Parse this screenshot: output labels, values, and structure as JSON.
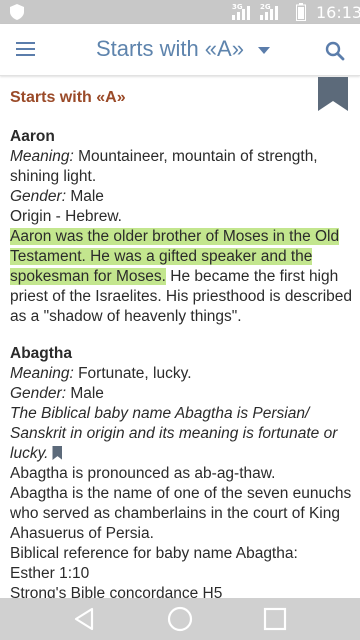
{
  "status_bar": {
    "time": "16:13",
    "network_1": "3G",
    "network_2": "2G"
  },
  "app_bar": {
    "title": "Starts with «A»"
  },
  "section": {
    "heading": "Starts with «A»"
  },
  "entries": [
    {
      "name": "Aaron",
      "meaning_label": "Meaning:",
      "meaning": "Mountaineer, mountain of strength, shining light.",
      "gender_label": "Gender:",
      "gender": "Male",
      "origin": "Origin - Hebrew.",
      "highlighted_text": "Aaron was the older brother of Moses in the Old Testament. He was a gifted speaker and the spokesman for Moses.",
      "description_rest": " He became the first high priest of the Israelites. His priesthood is described as a \"shadow of heavenly things\"."
    },
    {
      "name": "Abagtha",
      "meaning_label": "Meaning:",
      "meaning": "Fortunate, lucky.",
      "gender_label": "Gender:",
      "gender": "Male",
      "italic_note": "The Biblical baby name Abagtha is Persian/ Sanskrit in origin and its meaning is fortunate or lucky.",
      "pronunciation": "Abagtha is pronounced as ab-ag-thaw.",
      "description": "Abagtha is the name of one of the seven eunuchs who served as chamberlains in the court of King Ahasuerus of Persia.",
      "reference_label": "Biblical reference for baby name Abagtha:",
      "reference": "Esther 1:10",
      "concordance": "Strong's Bible concordance H5"
    }
  ],
  "colors": {
    "title": "#5e84ad",
    "heading": "#9a4a28",
    "highlight": "#c3e68e",
    "ribbon": "#5c6a7a"
  }
}
